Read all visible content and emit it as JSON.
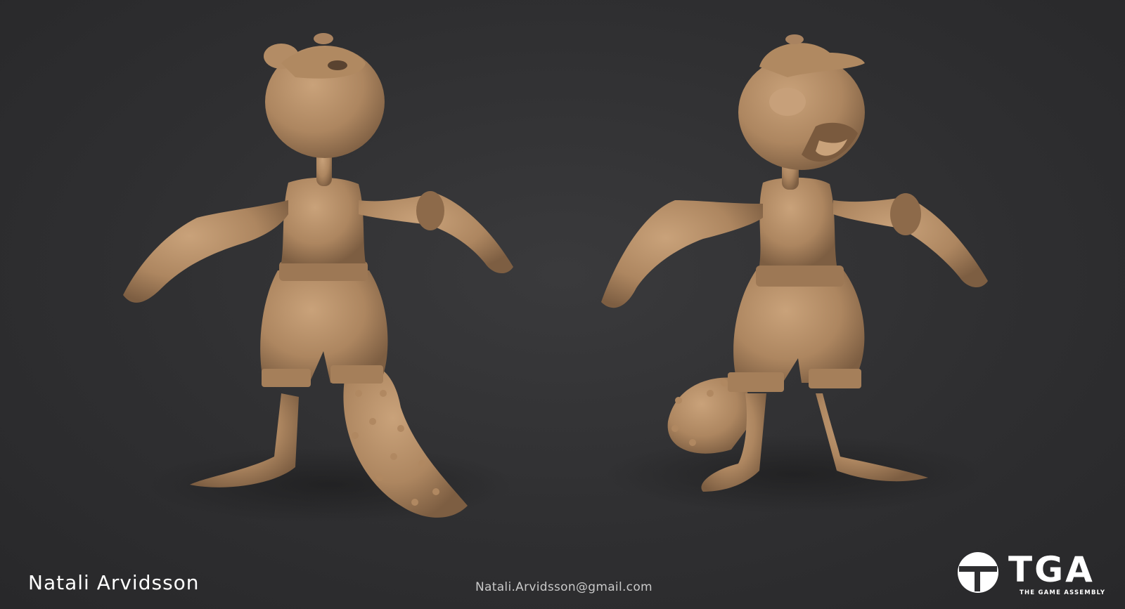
{
  "artist": {
    "name": "Natali Arvidsson"
  },
  "contact": {
    "email": "Natali.Arvidsson@gmail.com"
  },
  "logo": {
    "wordmark": "TGA",
    "tagline": "THE GAME ASSEMBLY"
  },
  "colors": {
    "background": "#2e2e30",
    "clay": "#b48d66",
    "clay_shadow": "#8a6a4b",
    "text": "#ffffff"
  }
}
